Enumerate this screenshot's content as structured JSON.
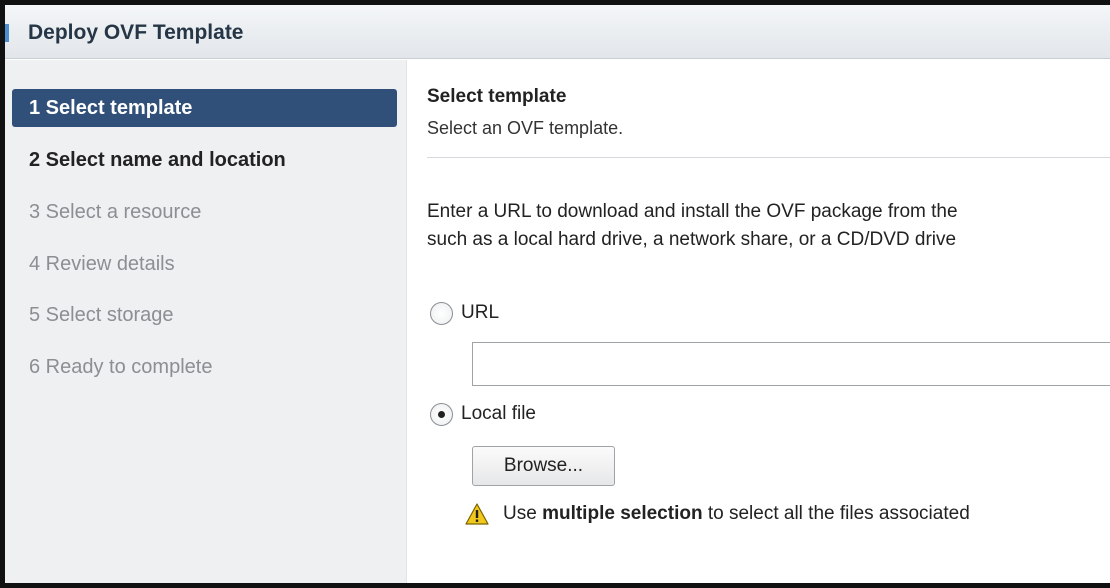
{
  "window": {
    "title": "Deploy OVF Template"
  },
  "sidebar": {
    "steps": [
      {
        "label": "1  Select template",
        "state": "active"
      },
      {
        "label": "2  Select name and location",
        "state": "done"
      },
      {
        "label": "3  Select a resource",
        "state": "pending"
      },
      {
        "label": "4  Review details",
        "state": "pending"
      },
      {
        "label": "5  Select storage",
        "state": "pending"
      },
      {
        "label": "6  Ready to complete",
        "state": "pending"
      }
    ]
  },
  "main": {
    "heading": "Select template",
    "subheading": "Select an OVF template.",
    "description_line1": "Enter a URL to download and install the OVF package from the",
    "description_line2": "such as a local hard drive, a network share, or a CD/DVD drive",
    "url_option": {
      "label": "URL",
      "selected": false
    },
    "url_input": {
      "value": "",
      "placeholder": ""
    },
    "local_option": {
      "label": "Local file",
      "selected": true
    },
    "browse_label": "Browse...",
    "note": {
      "prefix": "Use ",
      "bold": "multiple selection",
      "suffix": " to select all the files associated"
    }
  },
  "colors": {
    "active_step": "#30507a",
    "sidebar_bg": "#eef0f1",
    "title_accent": "#4b8fd1",
    "warning": "#f2c81c"
  },
  "icons": {
    "warning": "warning-icon"
  }
}
